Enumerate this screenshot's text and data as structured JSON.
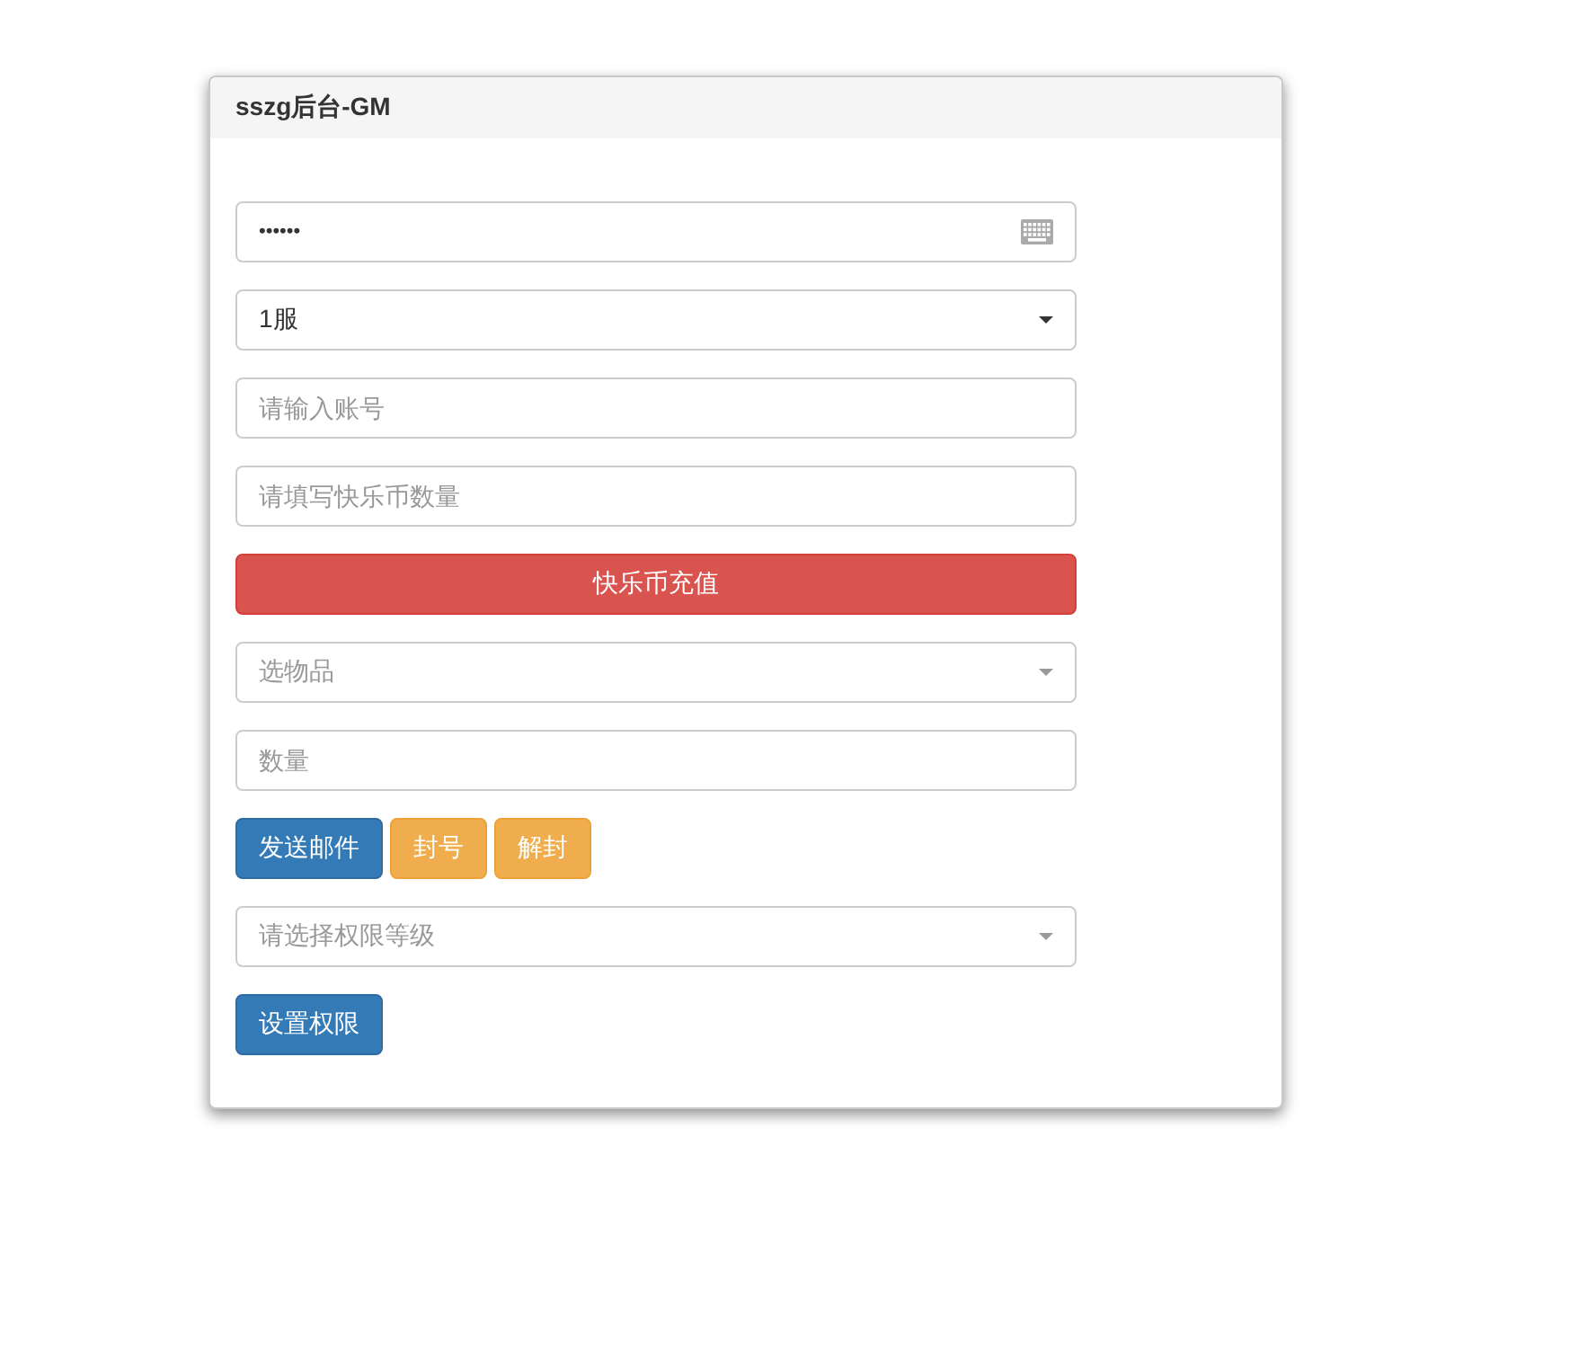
{
  "panel": {
    "title": "sszg后台-GM",
    "rows": [
      {
        "kind": "password",
        "value": "••••••"
      },
      {
        "kind": "select",
        "value": "1服"
      },
      {
        "kind": "input",
        "placeholder": "请输入账号"
      },
      {
        "kind": "input",
        "placeholder": "请填写快乐币数量"
      },
      {
        "kind": "buttons",
        "buttons": [
          {
            "label": "快乐币充值",
            "kind": "danger"
          }
        ]
      },
      {
        "kind": "select",
        "placeholder": "选物品"
      },
      {
        "kind": "input",
        "placeholder": "数量"
      },
      {
        "kind": "buttons",
        "buttons": [
          {
            "label": "发送邮件",
            "kind": "primary"
          },
          {
            "label": "封号",
            "kind": "warning"
          },
          {
            "label": "解封",
            "kind": "warning"
          }
        ]
      },
      {
        "kind": "select",
        "placeholder": "请选择权限等级"
      },
      {
        "kind": "buttons",
        "buttons": [
          {
            "label": "设置权限",
            "kind": "primary"
          }
        ]
      }
    ]
  }
}
